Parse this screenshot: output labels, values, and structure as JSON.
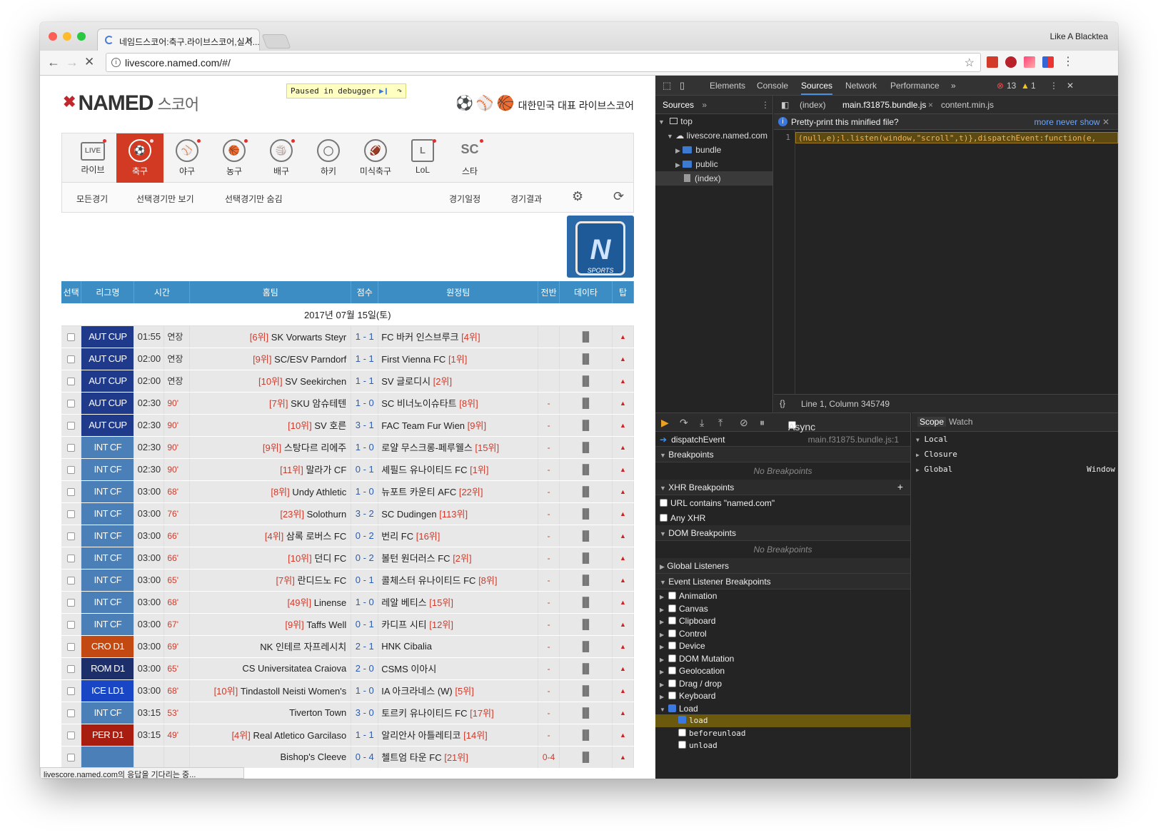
{
  "browser": {
    "tab_title": "네임드스코어:축구.라이브스코어,실시...",
    "url": "livescore.named.com/#/",
    "profile": "Like A Blacktea",
    "status_text": "livescore.named.com의 응답을 기다리는 중..."
  },
  "site": {
    "logo_text": "NAMED",
    "logo_sub": "스코어",
    "paused_label": "Paused in debugger",
    "slogan": "대한민국 대표 라이브스코어",
    "sports": [
      {
        "label": "라이브",
        "icon": "LIVE"
      },
      {
        "label": "축구",
        "icon": "⚽"
      },
      {
        "label": "야구",
        "icon": "⚾"
      },
      {
        "label": "농구",
        "icon": "🏀"
      },
      {
        "label": "배구",
        "icon": "🏐"
      },
      {
        "label": "하키",
        "icon": "◯"
      },
      {
        "label": "미식축구",
        "icon": "🏈"
      },
      {
        "label": "LoL",
        "icon": "L"
      },
      {
        "label": "스타",
        "icon": "SC"
      }
    ],
    "filters": {
      "all": "모든경기",
      "show_selected": "선택경기만 보기",
      "hide_selected": "선택경기만 숨김",
      "schedule": "경기일정",
      "results": "경기결과"
    },
    "banner_text": "SPORTS",
    "table": {
      "headers": [
        "선택",
        "리그명",
        "시간",
        "홈팀",
        "점수",
        "원정팀",
        "전반",
        "데이타",
        "탑"
      ],
      "date": "2017년 07월 15일(토)",
      "rows": [
        {
          "league": "AUT CUP",
          "lc": "#1f3a8a",
          "time": "01:55",
          "status": "연장",
          "sg": true,
          "hr": "[6위]",
          "home": "SK Vorwarts Steyr",
          "score": "1 - 1",
          "away": "FC 바커 인스브루크",
          "ar": "[4위]",
          "ht": ""
        },
        {
          "league": "AUT CUP",
          "lc": "#1f3a8a",
          "time": "02:00",
          "status": "연장",
          "sg": true,
          "hr": "[9위]",
          "home": "SC/ESV Parndorf",
          "score": "1 - 1",
          "away": "First Vienna FC",
          "ar": "[1위]",
          "ht": ""
        },
        {
          "league": "AUT CUP",
          "lc": "#1f3a8a",
          "time": "02:00",
          "status": "연장",
          "sg": true,
          "hr": "[10위]",
          "home": "SV Seekirchen",
          "score": "1 - 1",
          "away": "SV 글로디시",
          "ar": "[2위]",
          "ht": ""
        },
        {
          "league": "AUT CUP",
          "lc": "#1f3a8a",
          "time": "02:30",
          "status": "90'",
          "sg": false,
          "hr": "[7위]",
          "home": "SKU 암슈테텐",
          "score": "1 - 0",
          "away": "SC 비너노이슈타트",
          "ar": "[8위]",
          "ht": "-"
        },
        {
          "league": "AUT CUP",
          "lc": "#1f3a8a",
          "time": "02:30",
          "status": "90'",
          "sg": false,
          "hr": "[10위]",
          "home": "SV 호른",
          "score": "3 - 1",
          "away": "FAC Team Fur Wien",
          "ar": "[9위]",
          "ht": "-"
        },
        {
          "league": "INT CF",
          "lc": "#4a7fb8",
          "time": "02:30",
          "status": "90'",
          "sg": false,
          "hr": "[9위]",
          "home": "스탕다르 리에주",
          "score": "1 - 0",
          "away": "로얄 무스크롱-페루웰스",
          "ar": "[15위]",
          "ht": "-"
        },
        {
          "league": "INT CF",
          "lc": "#4a7fb8",
          "time": "02:30",
          "status": "90'",
          "sg": false,
          "hr": "[11위]",
          "home": "말라가 CF",
          "score": "0 - 1",
          "away": "셰필드 유나이티드 FC",
          "ar": "[1위]",
          "ht": "-"
        },
        {
          "league": "INT CF",
          "lc": "#4a7fb8",
          "time": "03:00",
          "status": "68'",
          "sg": false,
          "hr": "[8위]",
          "home": "Undy Athletic",
          "score": "1 - 0",
          "away": "뉴포트 카운티 AFC",
          "ar": "[22위]",
          "ht": "-"
        },
        {
          "league": "INT CF",
          "lc": "#4a7fb8",
          "time": "03:00",
          "status": "76'",
          "sg": false,
          "hr": "[23위]",
          "home": "Solothurn",
          "score": "3 - 2",
          "away": "SC Dudingen",
          "ar": "[113위]",
          "ht": "-"
        },
        {
          "league": "INT CF",
          "lc": "#4a7fb8",
          "time": "03:00",
          "status": "66'",
          "sg": false,
          "hr": "[4위]",
          "home": "삼록 로버스 FC",
          "score": "0 - 2",
          "away": "번리 FC",
          "ar": "[16위]",
          "ht": "-"
        },
        {
          "league": "INT CF",
          "lc": "#4a7fb8",
          "time": "03:00",
          "status": "66'",
          "sg": false,
          "hr": "[10위]",
          "home": "던디 FC",
          "score": "0 - 2",
          "away": "볼턴 원더러스 FC",
          "ar": "[2위]",
          "ht": "-"
        },
        {
          "league": "INT CF",
          "lc": "#4a7fb8",
          "time": "03:00",
          "status": "65'",
          "sg": false,
          "hr": "[7위]",
          "home": "란디드노 FC",
          "score": "0 - 1",
          "away": "콜체스터 유나이티드 FC",
          "ar": "[8위]",
          "ht": "-"
        },
        {
          "league": "INT CF",
          "lc": "#4a7fb8",
          "time": "03:00",
          "status": "68'",
          "sg": false,
          "hr": "[49위]",
          "home": "Linense",
          "score": "1 - 0",
          "away": "레알 베티스",
          "ar": "[15위]",
          "ht": "-"
        },
        {
          "league": "INT CF",
          "lc": "#4a7fb8",
          "time": "03:00",
          "status": "67'",
          "sg": false,
          "hr": "[9위]",
          "home": "Taffs Well",
          "score": "0 - 1",
          "away": "카디프 시티",
          "ar": "[12위]",
          "ht": "-"
        },
        {
          "league": "CRO D1",
          "lc": "#c24a12",
          "time": "03:00",
          "status": "69'",
          "sg": false,
          "hr": "",
          "home": "NK 인테르 자프레시치",
          "score": "2 - 1",
          "away": "HNK Cibalia",
          "ar": "",
          "ht": "-"
        },
        {
          "league": "ROM D1",
          "lc": "#1d2f6b",
          "time": "03:00",
          "status": "65'",
          "sg": false,
          "hr": "",
          "home": "CS Universitatea Craiova",
          "score": "2 - 0",
          "away": "CSMS 이아시",
          "ar": "",
          "ht": "-"
        },
        {
          "league": "ICE LD1",
          "lc": "#1846c4",
          "time": "03:00",
          "status": "68'",
          "sg": false,
          "hr": "[10위]",
          "home": "Tindastoll Neisti Women's",
          "score": "1 - 0",
          "away": "IA 아크라네스 (W)",
          "ar": "[5위]",
          "ht": "-"
        },
        {
          "league": "INT CF",
          "lc": "#4a7fb8",
          "time": "03:15",
          "status": "53'",
          "sg": false,
          "hr": "",
          "home": "Tiverton Town",
          "score": "3 - 0",
          "away": "토르키 유나이티드 FC",
          "ar": "[17위]",
          "ht": "-"
        },
        {
          "league": "PER D1",
          "lc": "#a81d10",
          "time": "03:15",
          "status": "49'",
          "sg": false,
          "hr": "[4위]",
          "home": "Real Atletico Garcilaso",
          "score": "1 - 1",
          "away": "알리안사 아틀레티코",
          "ar": "[14위]",
          "ht": "-"
        },
        {
          "league": "",
          "lc": "#4a7fb8",
          "time": "",
          "status": "",
          "sg": false,
          "hr": "",
          "home": "Bishop's Cleeve",
          "score": "0 - 4",
          "away": "첼트엄 타운 FC",
          "ar": "[21위]",
          "ht": "0-4"
        }
      ]
    }
  },
  "devtools": {
    "tabs": [
      "Elements",
      "Console",
      "Sources",
      "Network",
      "Performance"
    ],
    "errors": "13",
    "warnings": "1",
    "nav_header": "Sources",
    "tree": {
      "top": "top",
      "domain": "livescore.named.com",
      "folders": [
        "bundle",
        "public"
      ],
      "index": "(index)"
    },
    "editor_tabs": [
      "(index)",
      "main.f31875.bundle.js",
      "content.min.js"
    ],
    "pretty_print": "Pretty-print this minified file?",
    "pp_more": "more",
    "pp_never": "never show",
    "line_no": "1",
    "code_line": "(null,e);l.listen(window,\"scroll\",t)},dispatchEvent:function(e,",
    "cursor_pos": "Line 1, Column 345749",
    "async": "Async",
    "call_frame": "dispatchEvent",
    "call_loc": "main.f31875.bundle.js:1",
    "breakpoints": "Breakpoints",
    "no_bp": "No Breakpoints",
    "xhr_bp": "XHR Breakpoints",
    "xhr_url": "URL contains \"named.com\"",
    "any_xhr": "Any XHR",
    "dom_bp": "DOM Breakpoints",
    "global_listeners": "Global Listeners",
    "event_bp": "Event Listener Breakpoints",
    "events": [
      "Animation",
      "Canvas",
      "Clipboard",
      "Control",
      "Device",
      "DOM Mutation",
      "Geolocation",
      "Drag / drop",
      "Keyboard",
      "Load"
    ],
    "load_children": [
      "load",
      "beforeunload",
      "unload"
    ],
    "scope_tabs": [
      "Scope",
      "Watch"
    ],
    "scope": {
      "local": "Local",
      "closure": "Closure",
      "global": "Global",
      "global_val": "Window"
    }
  }
}
